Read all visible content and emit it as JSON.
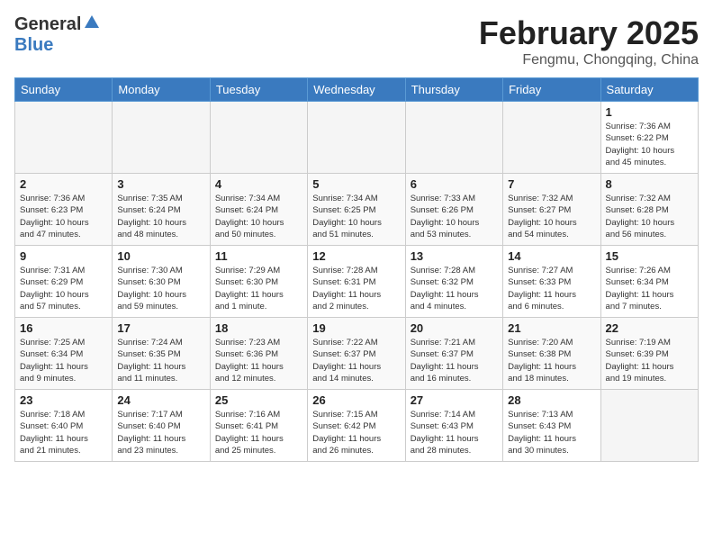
{
  "logo": {
    "general": "General",
    "blue": "Blue"
  },
  "title": "February 2025",
  "location": "Fengmu, Chongqing, China",
  "days_of_week": [
    "Sunday",
    "Monday",
    "Tuesday",
    "Wednesday",
    "Thursday",
    "Friday",
    "Saturday"
  ],
  "weeks": [
    [
      {
        "day": "",
        "info": ""
      },
      {
        "day": "",
        "info": ""
      },
      {
        "day": "",
        "info": ""
      },
      {
        "day": "",
        "info": ""
      },
      {
        "day": "",
        "info": ""
      },
      {
        "day": "",
        "info": ""
      },
      {
        "day": "1",
        "info": "Sunrise: 7:36 AM\nSunset: 6:22 PM\nDaylight: 10 hours\nand 45 minutes."
      }
    ],
    [
      {
        "day": "2",
        "info": "Sunrise: 7:36 AM\nSunset: 6:23 PM\nDaylight: 10 hours\nand 47 minutes."
      },
      {
        "day": "3",
        "info": "Sunrise: 7:35 AM\nSunset: 6:24 PM\nDaylight: 10 hours\nand 48 minutes."
      },
      {
        "day": "4",
        "info": "Sunrise: 7:34 AM\nSunset: 6:24 PM\nDaylight: 10 hours\nand 50 minutes."
      },
      {
        "day": "5",
        "info": "Sunrise: 7:34 AM\nSunset: 6:25 PM\nDaylight: 10 hours\nand 51 minutes."
      },
      {
        "day": "6",
        "info": "Sunrise: 7:33 AM\nSunset: 6:26 PM\nDaylight: 10 hours\nand 53 minutes."
      },
      {
        "day": "7",
        "info": "Sunrise: 7:32 AM\nSunset: 6:27 PM\nDaylight: 10 hours\nand 54 minutes."
      },
      {
        "day": "8",
        "info": "Sunrise: 7:32 AM\nSunset: 6:28 PM\nDaylight: 10 hours\nand 56 minutes."
      }
    ],
    [
      {
        "day": "9",
        "info": "Sunrise: 7:31 AM\nSunset: 6:29 PM\nDaylight: 10 hours\nand 57 minutes."
      },
      {
        "day": "10",
        "info": "Sunrise: 7:30 AM\nSunset: 6:30 PM\nDaylight: 10 hours\nand 59 minutes."
      },
      {
        "day": "11",
        "info": "Sunrise: 7:29 AM\nSunset: 6:30 PM\nDaylight: 11 hours\nand 1 minute."
      },
      {
        "day": "12",
        "info": "Sunrise: 7:28 AM\nSunset: 6:31 PM\nDaylight: 11 hours\nand 2 minutes."
      },
      {
        "day": "13",
        "info": "Sunrise: 7:28 AM\nSunset: 6:32 PM\nDaylight: 11 hours\nand 4 minutes."
      },
      {
        "day": "14",
        "info": "Sunrise: 7:27 AM\nSunset: 6:33 PM\nDaylight: 11 hours\nand 6 minutes."
      },
      {
        "day": "15",
        "info": "Sunrise: 7:26 AM\nSunset: 6:34 PM\nDaylight: 11 hours\nand 7 minutes."
      }
    ],
    [
      {
        "day": "16",
        "info": "Sunrise: 7:25 AM\nSunset: 6:34 PM\nDaylight: 11 hours\nand 9 minutes."
      },
      {
        "day": "17",
        "info": "Sunrise: 7:24 AM\nSunset: 6:35 PM\nDaylight: 11 hours\nand 11 minutes."
      },
      {
        "day": "18",
        "info": "Sunrise: 7:23 AM\nSunset: 6:36 PM\nDaylight: 11 hours\nand 12 minutes."
      },
      {
        "day": "19",
        "info": "Sunrise: 7:22 AM\nSunset: 6:37 PM\nDaylight: 11 hours\nand 14 minutes."
      },
      {
        "day": "20",
        "info": "Sunrise: 7:21 AM\nSunset: 6:37 PM\nDaylight: 11 hours\nand 16 minutes."
      },
      {
        "day": "21",
        "info": "Sunrise: 7:20 AM\nSunset: 6:38 PM\nDaylight: 11 hours\nand 18 minutes."
      },
      {
        "day": "22",
        "info": "Sunrise: 7:19 AM\nSunset: 6:39 PM\nDaylight: 11 hours\nand 19 minutes."
      }
    ],
    [
      {
        "day": "23",
        "info": "Sunrise: 7:18 AM\nSunset: 6:40 PM\nDaylight: 11 hours\nand 21 minutes."
      },
      {
        "day": "24",
        "info": "Sunrise: 7:17 AM\nSunset: 6:40 PM\nDaylight: 11 hours\nand 23 minutes."
      },
      {
        "day": "25",
        "info": "Sunrise: 7:16 AM\nSunset: 6:41 PM\nDaylight: 11 hours\nand 25 minutes."
      },
      {
        "day": "26",
        "info": "Sunrise: 7:15 AM\nSunset: 6:42 PM\nDaylight: 11 hours\nand 26 minutes."
      },
      {
        "day": "27",
        "info": "Sunrise: 7:14 AM\nSunset: 6:43 PM\nDaylight: 11 hours\nand 28 minutes."
      },
      {
        "day": "28",
        "info": "Sunrise: 7:13 AM\nSunset: 6:43 PM\nDaylight: 11 hours\nand 30 minutes."
      },
      {
        "day": "",
        "info": ""
      }
    ]
  ]
}
